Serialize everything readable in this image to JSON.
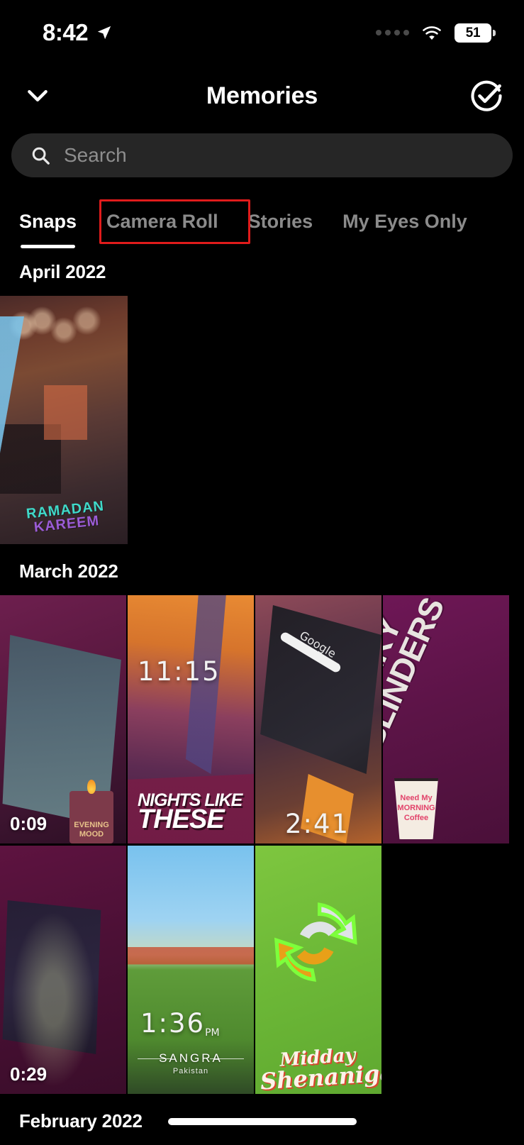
{
  "status_bar": {
    "time": "8:42",
    "location_icon": "location-arrow-icon",
    "signal_icon": "signal-dots-icon",
    "wifi_icon": "wifi-icon",
    "battery_level": "51"
  },
  "header": {
    "collapse_icon": "chevron-down-icon",
    "title": "Memories",
    "select_icon": "circle-check-icon"
  },
  "search": {
    "icon": "search-icon",
    "placeholder": "Search",
    "value": ""
  },
  "tabs": [
    {
      "label": "Snaps",
      "active": true
    },
    {
      "label": "Camera Roll",
      "active": false,
      "annotated": true
    },
    {
      "label": "Stories",
      "active": false
    },
    {
      "label": "My Eyes Only",
      "active": false
    }
  ],
  "annotation": {
    "color": "#e01b1b",
    "target": "Camera Roll"
  },
  "sections": [
    {
      "month": "April 2022",
      "items": [
        {
          "name": "snap-laptop-restaurant",
          "duration": "",
          "overlay_text": [
            "RAMADAN",
            "KAREEM"
          ],
          "stickers": [
            "ramadan-kareem-sticker"
          ]
        }
      ]
    },
    {
      "month": "March 2022",
      "items": [
        {
          "name": "snap-evening-window",
          "duration": "0:09",
          "overlay_text": [
            "EVENING",
            "MOOD"
          ],
          "stickers": [
            "candle-sticker"
          ]
        },
        {
          "name": "snap-nights-like-these",
          "duration": "",
          "timestamp": "11:15",
          "overlay_text": [
            "NIGHTS LIKE",
            "THESE"
          ],
          "stickers": [
            "nights-like-these-sticker"
          ]
        },
        {
          "name": "snap-laptop-google",
          "duration": "",
          "timestamp": "2:41",
          "overlay_text": [
            "Google"
          ],
          "stickers": [
            "time-sticker"
          ]
        },
        {
          "name": "snap-peaky-blinders",
          "duration": "",
          "overlay_text": [
            "PEAKY",
            "BLINDERS",
            "Need My",
            "MORNING",
            "Coffee"
          ],
          "stickers": [
            "coffee-cup-sticker"
          ]
        },
        {
          "name": "snap-dark-room",
          "duration": "0:29",
          "overlay_text": [],
          "stickers": []
        },
        {
          "name": "snap-sangra-park",
          "duration": "",
          "timestamp": "1:36",
          "timestamp_suffix": "PM",
          "overlay_text": [
            "SANGRA",
            "Pakistan"
          ],
          "stickers": [
            "location-sticker"
          ]
        },
        {
          "name": "snap-midday-shenanigans",
          "duration": "",
          "overlay_text": [
            "Midday",
            "Shenanigans"
          ],
          "stickers": [
            "midday-shenanigans-sticker"
          ]
        }
      ]
    },
    {
      "month": "February 2022",
      "items": []
    }
  ],
  "colors": {
    "background": "#000000",
    "search_field": "#262626",
    "tab_inactive": "#8b8b8b",
    "tab_active": "#ffffff",
    "annotation_red": "#e01b1b"
  }
}
